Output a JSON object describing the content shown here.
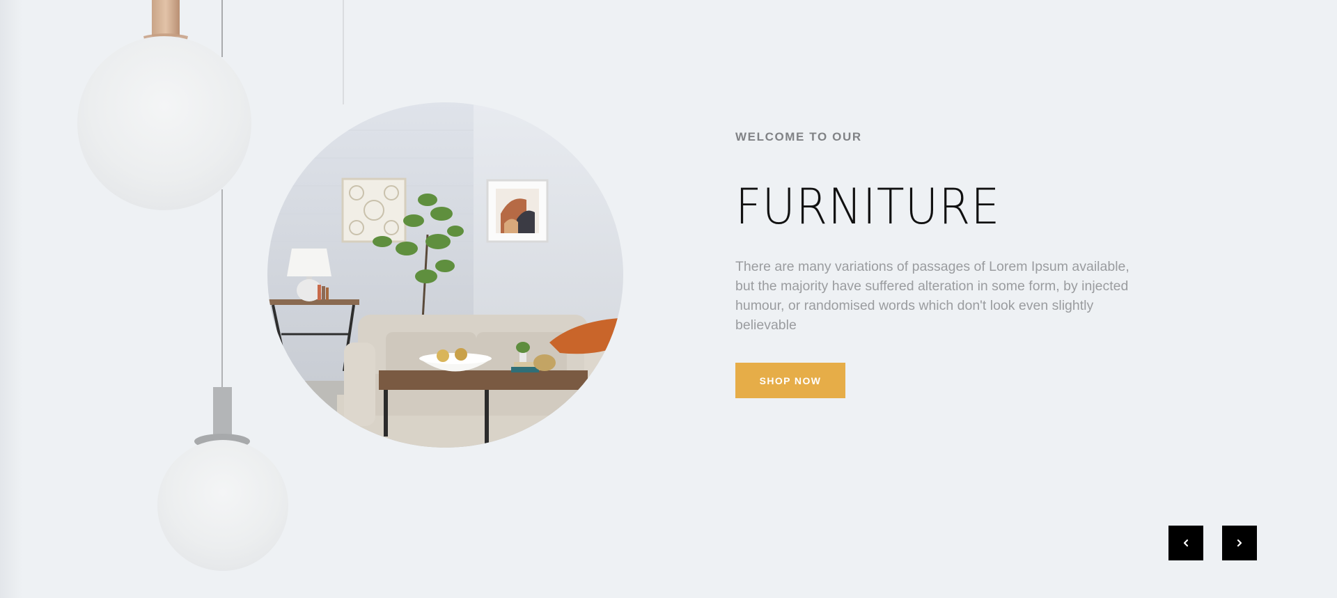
{
  "hero": {
    "eyebrow": "WELCOME TO OUR",
    "headline": "FURNITURE",
    "blurb": "There are many variations of passages of Lorem Ipsum available, but the majority have suffered alteration in some form, by injected humour, or randomised words which don't look even slightly believable",
    "cta_label": "SHOP NOW"
  },
  "slider": {
    "prev_icon": "chevron-left-icon",
    "next_icon": "chevron-right-icon"
  },
  "colors": {
    "background": "#eef1f4",
    "accent": "#e6ad48",
    "headline": "#111111",
    "body_text": "#9a9c9f",
    "nav_bg": "#000000"
  }
}
